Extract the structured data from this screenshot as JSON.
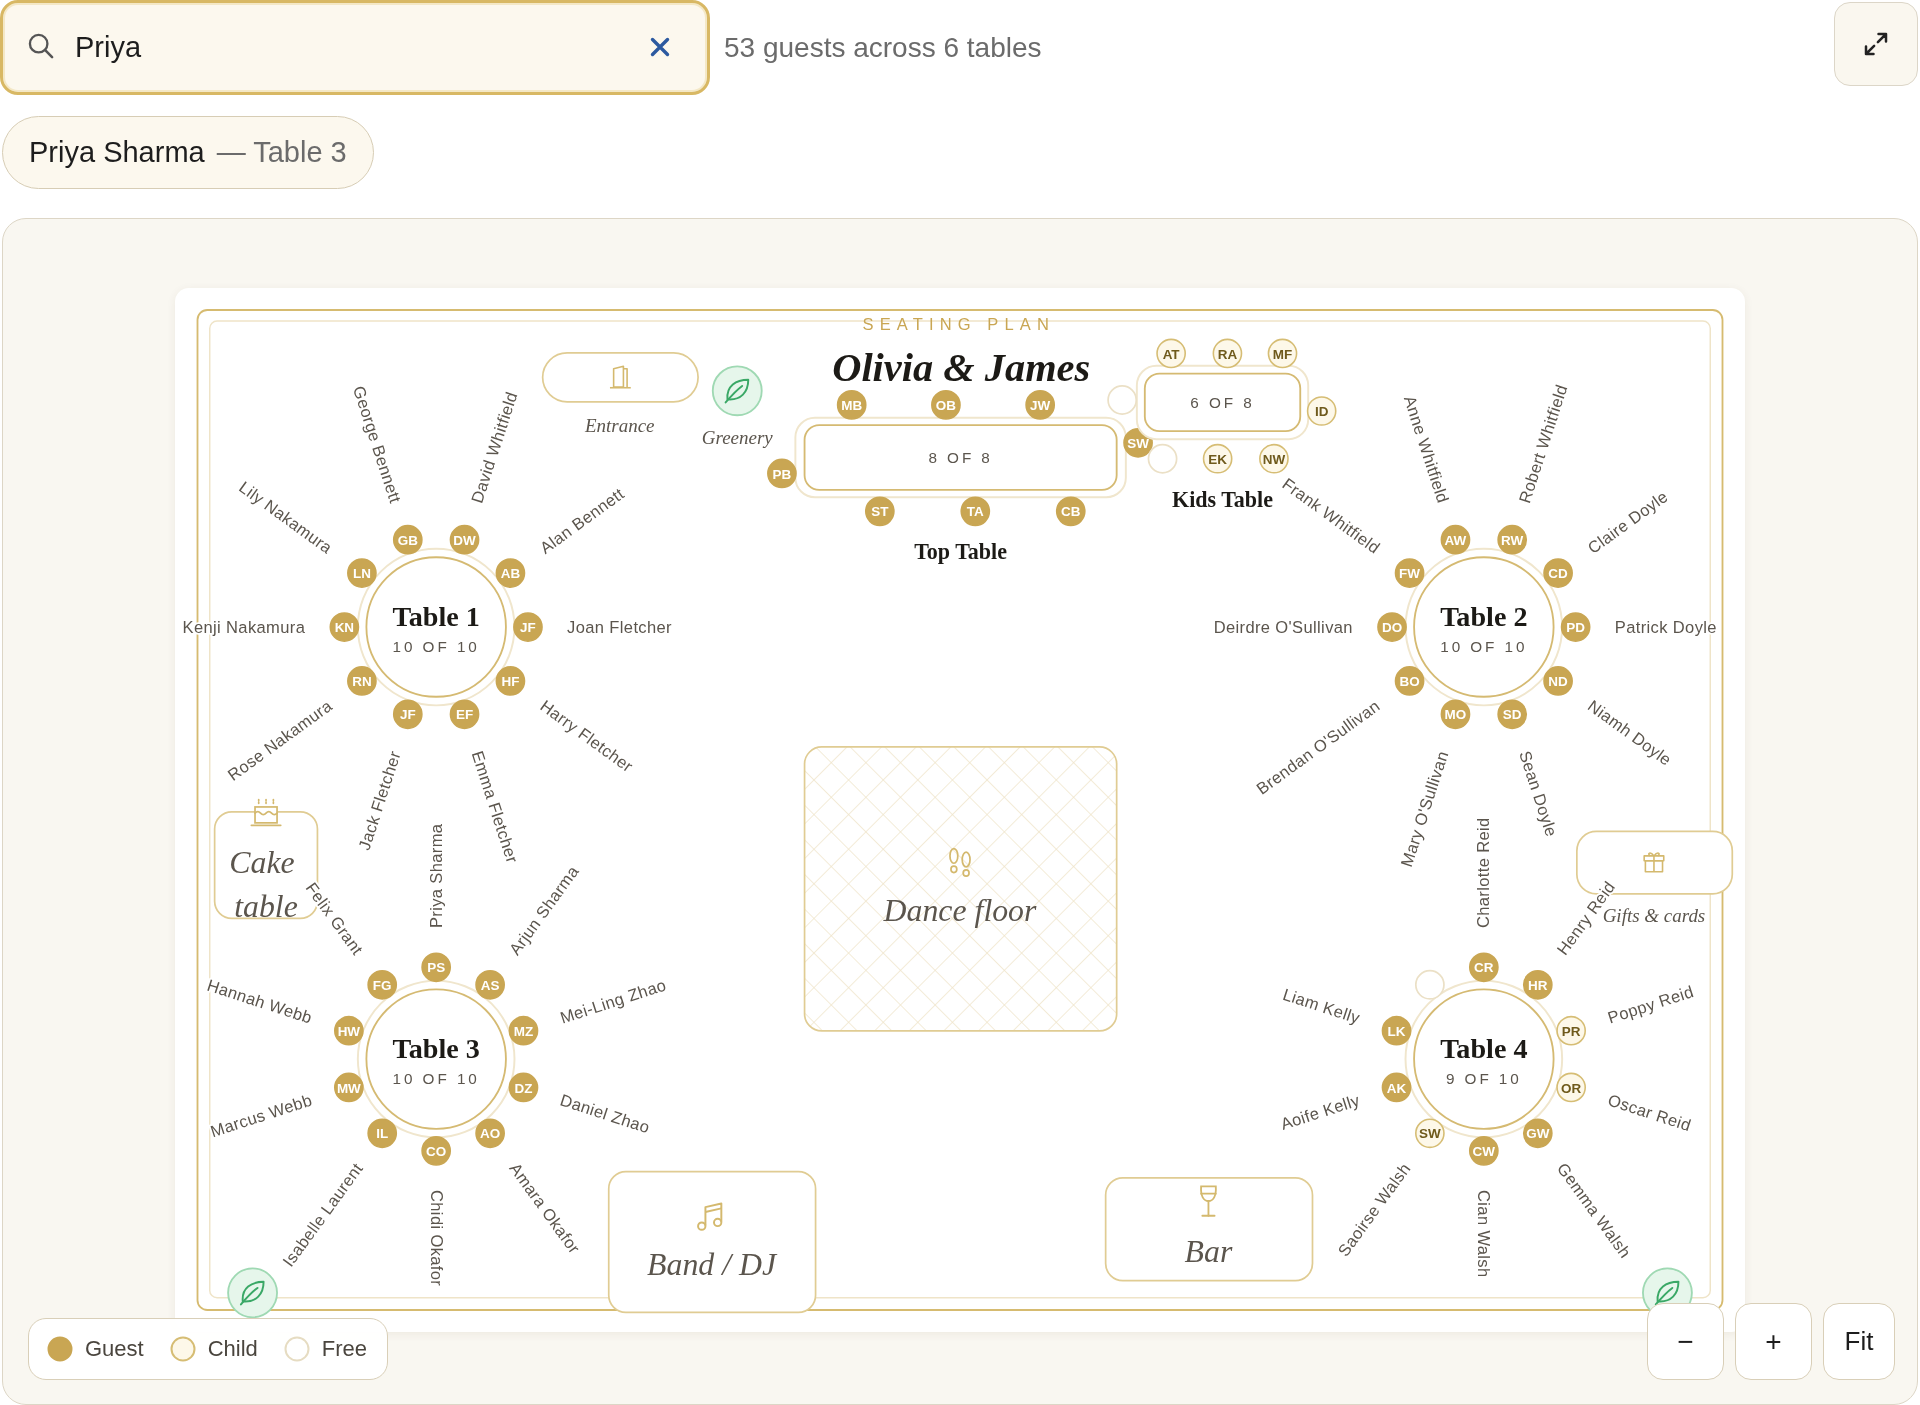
{
  "search": {
    "value": "Priya"
  },
  "summary": "53 guests across 6 tables",
  "results": [
    {
      "name": "Priya Sharma",
      "detail": "— Table 3"
    }
  ],
  "plan": {
    "eyebrow": "SEATING PLAN",
    "title": "Olivia & James",
    "tables": [
      {
        "kind": "rect",
        "label": "Top Table",
        "capacity": "8 OF 8",
        "seats": [
          {
            "kind": "guest",
            "initials": "MB"
          },
          {
            "kind": "guest",
            "initials": "OB"
          },
          {
            "kind": "guest",
            "initials": "JW"
          },
          {
            "kind": "guest",
            "initials": "SW"
          },
          {
            "kind": "guest",
            "initials": "PB"
          },
          {
            "kind": "guest",
            "initials": "ST"
          },
          {
            "kind": "guest",
            "initials": "TA"
          },
          {
            "kind": "guest",
            "initials": "CB"
          }
        ]
      },
      {
        "kind": "rect",
        "label": "Kids Table",
        "capacity": "6 OF 8",
        "seats": [
          {
            "kind": "child",
            "initials": "AT"
          },
          {
            "kind": "child",
            "initials": "RA"
          },
          {
            "kind": "child",
            "initials": "MF"
          },
          {
            "kind": "free"
          },
          {
            "kind": "child",
            "initials": "ID"
          },
          {
            "kind": "free"
          },
          {
            "kind": "child",
            "initials": "EK"
          },
          {
            "kind": "child",
            "initials": "NW"
          }
        ]
      },
      {
        "kind": "round",
        "label": "Table 1",
        "capacity": "10 OF 10",
        "seats": [
          {
            "kind": "guest",
            "initials": "GB",
            "name": "George Bennett"
          },
          {
            "kind": "guest",
            "initials": "DW",
            "name": "David Whitfield"
          },
          {
            "kind": "guest",
            "initials": "LN",
            "name": "Lily Nakamura"
          },
          {
            "kind": "guest",
            "initials": "AB",
            "name": "Alan Bennett"
          },
          {
            "kind": "guest",
            "initials": "KN",
            "name": "Kenji Nakamura"
          },
          {
            "kind": "guest",
            "initials": "JF",
            "name": "Joan Fletcher"
          },
          {
            "kind": "guest",
            "initials": "RN",
            "name": "Rose Nakamura"
          },
          {
            "kind": "guest",
            "initials": "HF",
            "name": "Harry Fletcher"
          },
          {
            "kind": "guest",
            "initials": "JF",
            "name": "Jack Fletcher"
          },
          {
            "kind": "guest",
            "initials": "EF",
            "name": "Emma Fletcher"
          }
        ]
      },
      {
        "kind": "round",
        "label": "Table 2",
        "capacity": "10 OF 10",
        "seats": [
          {
            "kind": "guest",
            "initials": "AW",
            "name": "Anne Whitfield"
          },
          {
            "kind": "guest",
            "initials": "RW",
            "name": "Robert Whitfield"
          },
          {
            "kind": "guest",
            "initials": "FW",
            "name": "Frank Whitfield"
          },
          {
            "kind": "guest",
            "initials": "CD",
            "name": "Claire Doyle"
          },
          {
            "kind": "guest",
            "initials": "DO",
            "name": "Deirdre O'Sullivan"
          },
          {
            "kind": "guest",
            "initials": "PD",
            "name": "Patrick Doyle"
          },
          {
            "kind": "guest",
            "initials": "BO",
            "name": "Brendan O'Sullivan"
          },
          {
            "kind": "guest",
            "initials": "ND",
            "name": "Niamh Doyle"
          },
          {
            "kind": "guest",
            "initials": "MO",
            "name": "Mary O'Sullivan"
          },
          {
            "kind": "guest",
            "initials": "SD",
            "name": "Sean Doyle"
          }
        ]
      },
      {
        "kind": "round",
        "label": "Table 3",
        "capacity": "10 OF 10",
        "seats": [
          {
            "kind": "guest",
            "initials": "PS",
            "name": "Priya Sharma"
          },
          {
            "kind": "guest",
            "initials": "FG",
            "name": "Felix Grant"
          },
          {
            "kind": "guest",
            "initials": "AS",
            "name": "Arjun Sharma"
          },
          {
            "kind": "guest",
            "initials": "HW",
            "name": "Hannah Webb"
          },
          {
            "kind": "guest",
            "initials": "MZ",
            "name": "Mei-Ling Zhao"
          },
          {
            "kind": "guest",
            "initials": "MW",
            "name": "Marcus Webb"
          },
          {
            "kind": "guest",
            "initials": "DZ",
            "name": "Daniel Zhao"
          },
          {
            "kind": "guest",
            "initials": "IL",
            "name": "Isabelle Laurent"
          },
          {
            "kind": "guest",
            "initials": "AO",
            "name": "Amara Okafor"
          },
          {
            "kind": "guest",
            "initials": "CO",
            "name": "Chidi Okafor"
          }
        ]
      },
      {
        "kind": "round",
        "label": "Table 4",
        "capacity": "9 OF 10",
        "seats": [
          {
            "kind": "guest",
            "initials": "CR",
            "name": "Charlotte Reid"
          },
          {
            "kind": "free"
          },
          {
            "kind": "guest",
            "initials": "HR",
            "name": "Henry Reid"
          },
          {
            "kind": "guest",
            "initials": "LK",
            "name": "Liam Kelly"
          },
          {
            "kind": "child",
            "initials": "PR",
            "name": "Poppy Reid"
          },
          {
            "kind": "guest",
            "initials": "AK",
            "name": "Aoife Kelly"
          },
          {
            "kind": "child",
            "initials": "OR",
            "name": "Oscar Reid"
          },
          {
            "kind": "child",
            "initials": "SW",
            "name": "Saoirse Walsh"
          },
          {
            "kind": "guest",
            "initials": "GW",
            "name": "Gemma Walsh"
          },
          {
            "kind": "guest",
            "initials": "CW",
            "name": "Cian Walsh"
          }
        ]
      }
    ],
    "features": [
      {
        "kind": "entrance",
        "label": "Entrance"
      },
      {
        "kind": "greenery",
        "label": "Greenery"
      },
      {
        "kind": "cake",
        "label": "Cake table"
      },
      {
        "kind": "dance_floor",
        "label": "Dance floor"
      },
      {
        "kind": "band",
        "label": "Band / DJ"
      },
      {
        "kind": "bar",
        "label": "Bar"
      },
      {
        "kind": "gifts",
        "label": "Gifts & cards"
      },
      {
        "kind": "greenery"
      },
      {
        "kind": "greenery"
      }
    ]
  },
  "legend": [
    {
      "kind": "guest",
      "label": "Guest"
    },
    {
      "kind": "child",
      "label": "Child"
    },
    {
      "kind": "free",
      "label": "Free"
    }
  ],
  "zoom_controls": [
    {
      "label": "−"
    },
    {
      "label": "+"
    },
    {
      "label": "Fit"
    }
  ]
}
